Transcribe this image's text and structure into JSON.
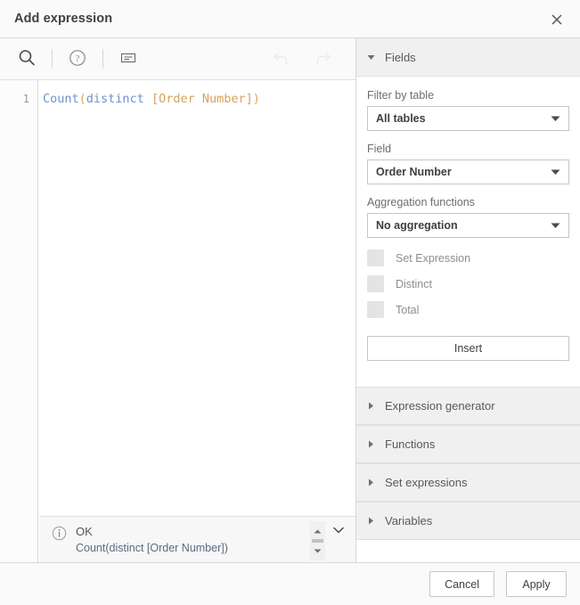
{
  "dialog": {
    "title": "Add expression",
    "close_icon": "close-icon"
  },
  "toolbar": {
    "search_icon": "search-icon",
    "help_icon": "help-circle-icon",
    "format_icon": "format-expression-icon",
    "undo_icon": "undo-arrow-icon",
    "redo_icon": "redo-arrow-icon"
  },
  "editor": {
    "line_number": "1",
    "tokens": {
      "fn_count": "Count",
      "paren_open": "(",
      "kw_distinct": "distinct",
      "space": " ",
      "field_ref": "[Order Number]",
      "paren_close": ")"
    },
    "full_expression": "Count(distinct [Order Number])",
    "colors": {
      "function": "#6f8fd6",
      "punctuation": "#e0a451",
      "field": "#d5a261"
    }
  },
  "status": {
    "info_icon": "info-circle-icon",
    "title": "OK",
    "detail": "Count(distinct [Order Number])",
    "scroll_up_icon": "scroll-up-arrow-icon",
    "scroll_down_icon": "scroll-down-arrow-icon",
    "expand_icon": "chevron-down-icon"
  },
  "panel": {
    "fields_section": {
      "label": "Fields",
      "expanded": true,
      "filter_by_table_label": "Filter by table",
      "filter_by_table_value": "All tables",
      "field_label": "Field",
      "field_value": "Order Number",
      "aggregation_label": "Aggregation functions",
      "aggregation_value": "No aggregation",
      "checkboxes": [
        {
          "label": "Set Expression",
          "checked": false
        },
        {
          "label": "Distinct",
          "checked": false
        },
        {
          "label": "Total",
          "checked": false
        }
      ],
      "insert_label": "Insert"
    },
    "collapsed_sections": [
      {
        "label": "Expression generator"
      },
      {
        "label": "Functions"
      },
      {
        "label": "Set expressions"
      },
      {
        "label": "Variables"
      }
    ]
  },
  "footer": {
    "cancel_label": "Cancel",
    "apply_label": "Apply"
  }
}
